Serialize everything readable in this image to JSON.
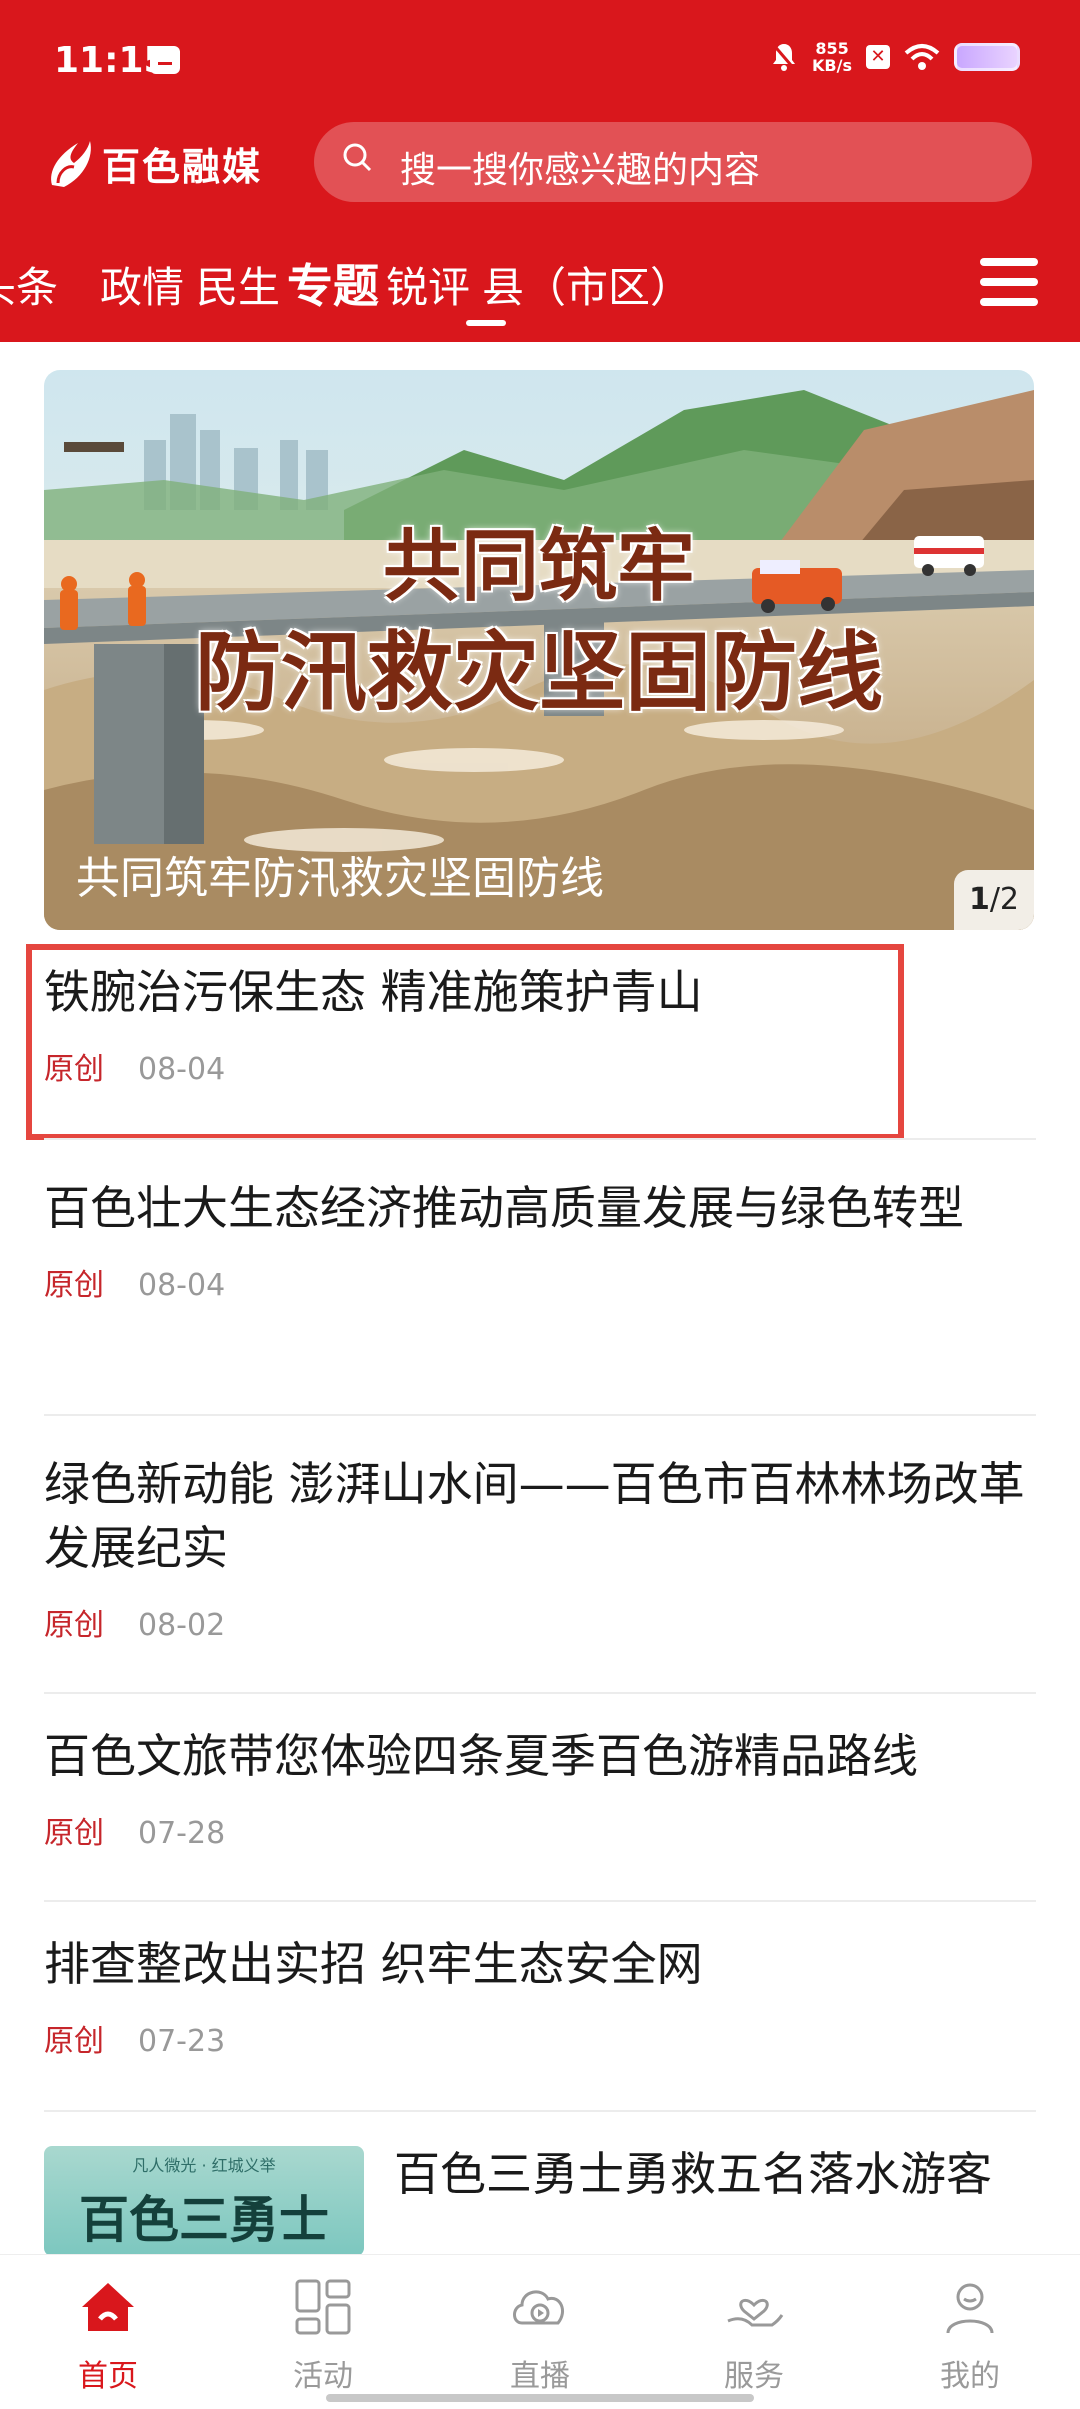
{
  "status_bar": {
    "time": "11:15",
    "net_speed_value": "855",
    "net_speed_unit": "KB/s"
  },
  "app": {
    "logo_text": "百色融媒",
    "search_placeholder": "搜一搜你感兴趣的内容"
  },
  "tabs": [
    {
      "label": "头条"
    },
    {
      "label": "政情"
    },
    {
      "label": "民生"
    },
    {
      "label": "专题",
      "active": true
    },
    {
      "label": "锐评"
    },
    {
      "label": "县（市区）"
    }
  ],
  "banner": {
    "headline_line1": "共同筑牢",
    "headline_line2": "防汛救灾坚固防线",
    "caption": "共同筑牢防汛救灾坚固防线",
    "index_current": "1",
    "index_total": "/2"
  },
  "news": [
    {
      "title": "铁腕治污保生态 精准施策护青山",
      "source": "原创",
      "date": "08-04"
    },
    {
      "title": "百色壮大生态经济推动高质量发展与绿色转型",
      "source": "原创",
      "date": "08-04"
    },
    {
      "title": "绿色新动能 澎湃山水间——百色市百林林场改革发展纪实",
      "source": "原创",
      "date": "08-02"
    },
    {
      "title": "百色文旅带您体验四条夏季百色游精品路线",
      "source": "原创",
      "date": "07-28"
    },
    {
      "title": "排查整改出实招 织牢生态安全网",
      "source": "原创",
      "date": "07-23"
    },
    {
      "title": "百色三勇士勇救五名落水游客",
      "thumb_text": "百色三勇士",
      "thumb_small": "凡人微光 · 红城义举"
    }
  ],
  "bottom_nav": [
    {
      "label": "首页",
      "active": true
    },
    {
      "label": "活动"
    },
    {
      "label": "直播"
    },
    {
      "label": "服务"
    },
    {
      "label": "我的"
    }
  ],
  "colors": {
    "brand_red": "#d9171c",
    "source_red": "#c6262b",
    "highlight_box": "#e5463f"
  }
}
